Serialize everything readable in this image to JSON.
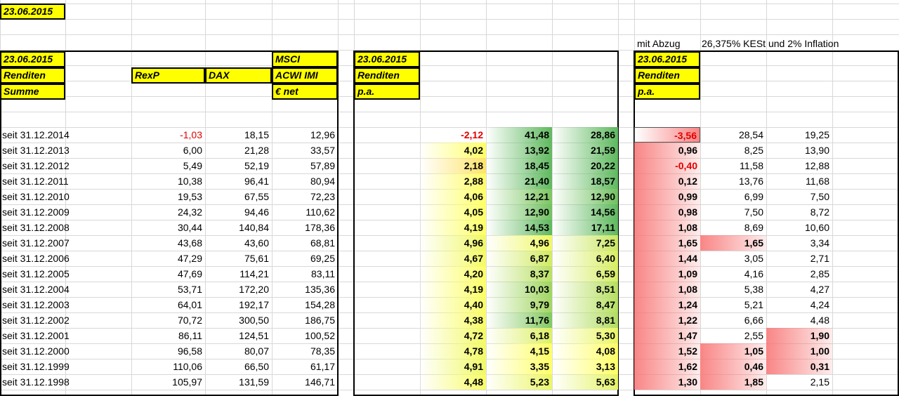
{
  "top_date": "23.06.2015",
  "note_mit": "mit Abzug",
  "note_kest": "26,375% KESt und 2% Inflation",
  "section1": {
    "date": "23.06.2015",
    "renditen": "Renditen",
    "summe": "Summe",
    "rexp": "RexP",
    "dax": "DAX",
    "msci1": "MSCI",
    "msci2": "ACWI IMI",
    "msci3": "€ net"
  },
  "section2": {
    "date": "23.06.2015",
    "renditen": "Renditen",
    "pa": "p.a."
  },
  "section3": {
    "date": "23.06.2015",
    "renditen": "Renditen",
    "pa": "p.a."
  },
  "rows": [
    {
      "label": "seit 31.12.2014",
      "s": [
        "-1,03",
        "18,15",
        "12,96"
      ],
      "p": [
        "-2,12",
        "41,48",
        "28,86"
      ],
      "k": [
        "-3,56",
        "28,54",
        "19,25"
      ]
    },
    {
      "label": "seit 31.12.2013",
      "s": [
        "6,00",
        "21,28",
        "33,57"
      ],
      "p": [
        "4,02",
        "13,92",
        "21,59"
      ],
      "k": [
        "0,96",
        "8,25",
        "13,90"
      ]
    },
    {
      "label": "seit 31.12.2012",
      "s": [
        "5,49",
        "52,19",
        "57,89"
      ],
      "p": [
        "2,18",
        "18,45",
        "20,22"
      ],
      "k": [
        "-0,40",
        "11,58",
        "12,88"
      ]
    },
    {
      "label": "seit 31.12.2011",
      "s": [
        "10,38",
        "96,41",
        "80,94"
      ],
      "p": [
        "2,88",
        "21,40",
        "18,57"
      ],
      "k": [
        "0,12",
        "13,76",
        "11,68"
      ]
    },
    {
      "label": "seit 31.12.2010",
      "s": [
        "19,53",
        "67,55",
        "72,23"
      ],
      "p": [
        "4,06",
        "12,21",
        "12,90"
      ],
      "k": [
        "0,99",
        "6,99",
        "7,50"
      ]
    },
    {
      "label": "seit 31.12.2009",
      "s": [
        "24,32",
        "94,46",
        "110,62"
      ],
      "p": [
        "4,05",
        "12,90",
        "14,56"
      ],
      "k": [
        "0,98",
        "7,50",
        "8,72"
      ]
    },
    {
      "label": "seit 31.12.2008",
      "s": [
        "30,44",
        "140,84",
        "178,36"
      ],
      "p": [
        "4,19",
        "14,53",
        "17,11"
      ],
      "k": [
        "1,08",
        "8,69",
        "10,60"
      ]
    },
    {
      "label": "seit 31.12.2007",
      "s": [
        "43,68",
        "43,60",
        "68,81"
      ],
      "p": [
        "4,96",
        "4,96",
        "7,25"
      ],
      "k": [
        "1,65",
        "1,65",
        "3,34"
      ]
    },
    {
      "label": "seit 31.12.2006",
      "s": [
        "47,29",
        "75,61",
        "69,25"
      ],
      "p": [
        "4,67",
        "6,87",
        "6,40"
      ],
      "k": [
        "1,44",
        "3,05",
        "2,71"
      ]
    },
    {
      "label": "seit 31.12.2005",
      "s": [
        "47,69",
        "114,21",
        "83,11"
      ],
      "p": [
        "4,20",
        "8,37",
        "6,59"
      ],
      "k": [
        "1,09",
        "4,16",
        "2,85"
      ]
    },
    {
      "label": "seit 31.12.2004",
      "s": [
        "53,71",
        "172,20",
        "135,36"
      ],
      "p": [
        "4,19",
        "10,03",
        "8,51"
      ],
      "k": [
        "1,08",
        "5,38",
        "4,27"
      ]
    },
    {
      "label": "seit 31.12.2003",
      "s": [
        "64,01",
        "192,17",
        "154,28"
      ],
      "p": [
        "4,40",
        "9,79",
        "8,47"
      ],
      "k": [
        "1,24",
        "5,21",
        "4,24"
      ]
    },
    {
      "label": "seit 31.12.2002",
      "s": [
        "70,72",
        "300,50",
        "186,75"
      ],
      "p": [
        "4,38",
        "11,76",
        "8,81"
      ],
      "k": [
        "1,22",
        "6,66",
        "4,48"
      ]
    },
    {
      "label": "seit 31.12.2001",
      "s": [
        "86,11",
        "124,51",
        "100,52"
      ],
      "p": [
        "4,72",
        "6,18",
        "5,30"
      ],
      "k": [
        "1,47",
        "2,55",
        "1,90"
      ]
    },
    {
      "label": "seit 31.12.2000",
      "s": [
        "96,58",
        "80,07",
        "78,35"
      ],
      "p": [
        "4,78",
        "4,15",
        "4,08"
      ],
      "k": [
        "1,52",
        "1,05",
        "1,00"
      ]
    },
    {
      "label": "seit 31.12.1999",
      "s": [
        "110,06",
        "66,50",
        "61,17"
      ],
      "p": [
        "4,91",
        "3,35",
        "3,13"
      ],
      "k": [
        "1,62",
        "0,46",
        "0,31"
      ]
    },
    {
      "label": "seit 31.12.1998",
      "s": [
        "105,97",
        "131,59",
        "146,71"
      ],
      "p": [
        "4,48",
        "5,23",
        "5,63"
      ],
      "k": [
        "1,30",
        "1,85",
        "2,15"
      ]
    }
  ],
  "colors": {
    "header_yellow": "#ffff00",
    "negative_red": "#e00000",
    "scale_green": "#5fb95f",
    "scale_yellow": "#ffff66",
    "scale_red": "#f87878"
  }
}
